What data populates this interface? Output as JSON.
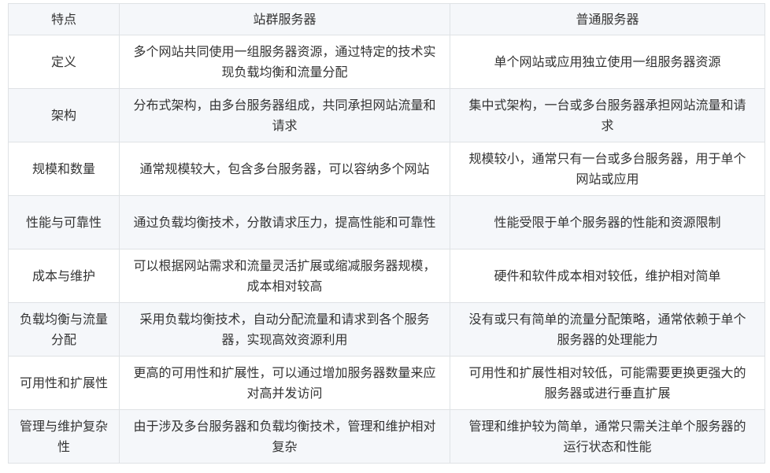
{
  "table": {
    "headers": [
      "特点",
      "站群服务器",
      "普通服务器"
    ],
    "rows": [
      [
        "定义",
        "多个网站共同使用一组服务器资源，通过特定的技术实现负载均衡和流量分配",
        "单个网站或应用独立使用一组服务器资源"
      ],
      [
        "架构",
        "分布式架构，由多台服务器组成，共同承担网站流量和请求",
        "集中式架构，一台或多台服务器承担网站流量和请求"
      ],
      [
        "规模和数量",
        "通常规模较大，包含多台服务器，可以容纳多个网站",
        "规模较小，通常只有一台或多台服务器，用于单个网站或应用"
      ],
      [
        "性能与可靠性",
        "通过负载均衡技术，分散请求压力，提高性能和可靠性",
        "性能受限于单个服务器的性能和资源限制"
      ],
      [
        "成本与维护",
        "可以根据网站需求和流量灵活扩展或缩减服务器规模，成本相对较高",
        "硬件和软件成本相对较低，维护相对简单"
      ],
      [
        "负载均衡与流量分配",
        "采用负载均衡技术，自动分配流量和请求到各个服务器，实现高效资源利用",
        "没有或只有简单的流量分配策略，通常依赖于单个服务器的处理能力"
      ],
      [
        "可用性和扩展性",
        "更高的可用性和扩展性，可以通过增加服务器数量来应对高并发访问",
        "可用性和扩展性相对较低，可能需要更换更强大的服务器或进行垂直扩展"
      ],
      [
        "管理与维护复杂性",
        "由于涉及多台服务器和负载均衡技术，管理和维护相对复杂",
        "管理和维护较为简单，通常只需关注单个服务器的运行状态和性能"
      ]
    ]
  }
}
